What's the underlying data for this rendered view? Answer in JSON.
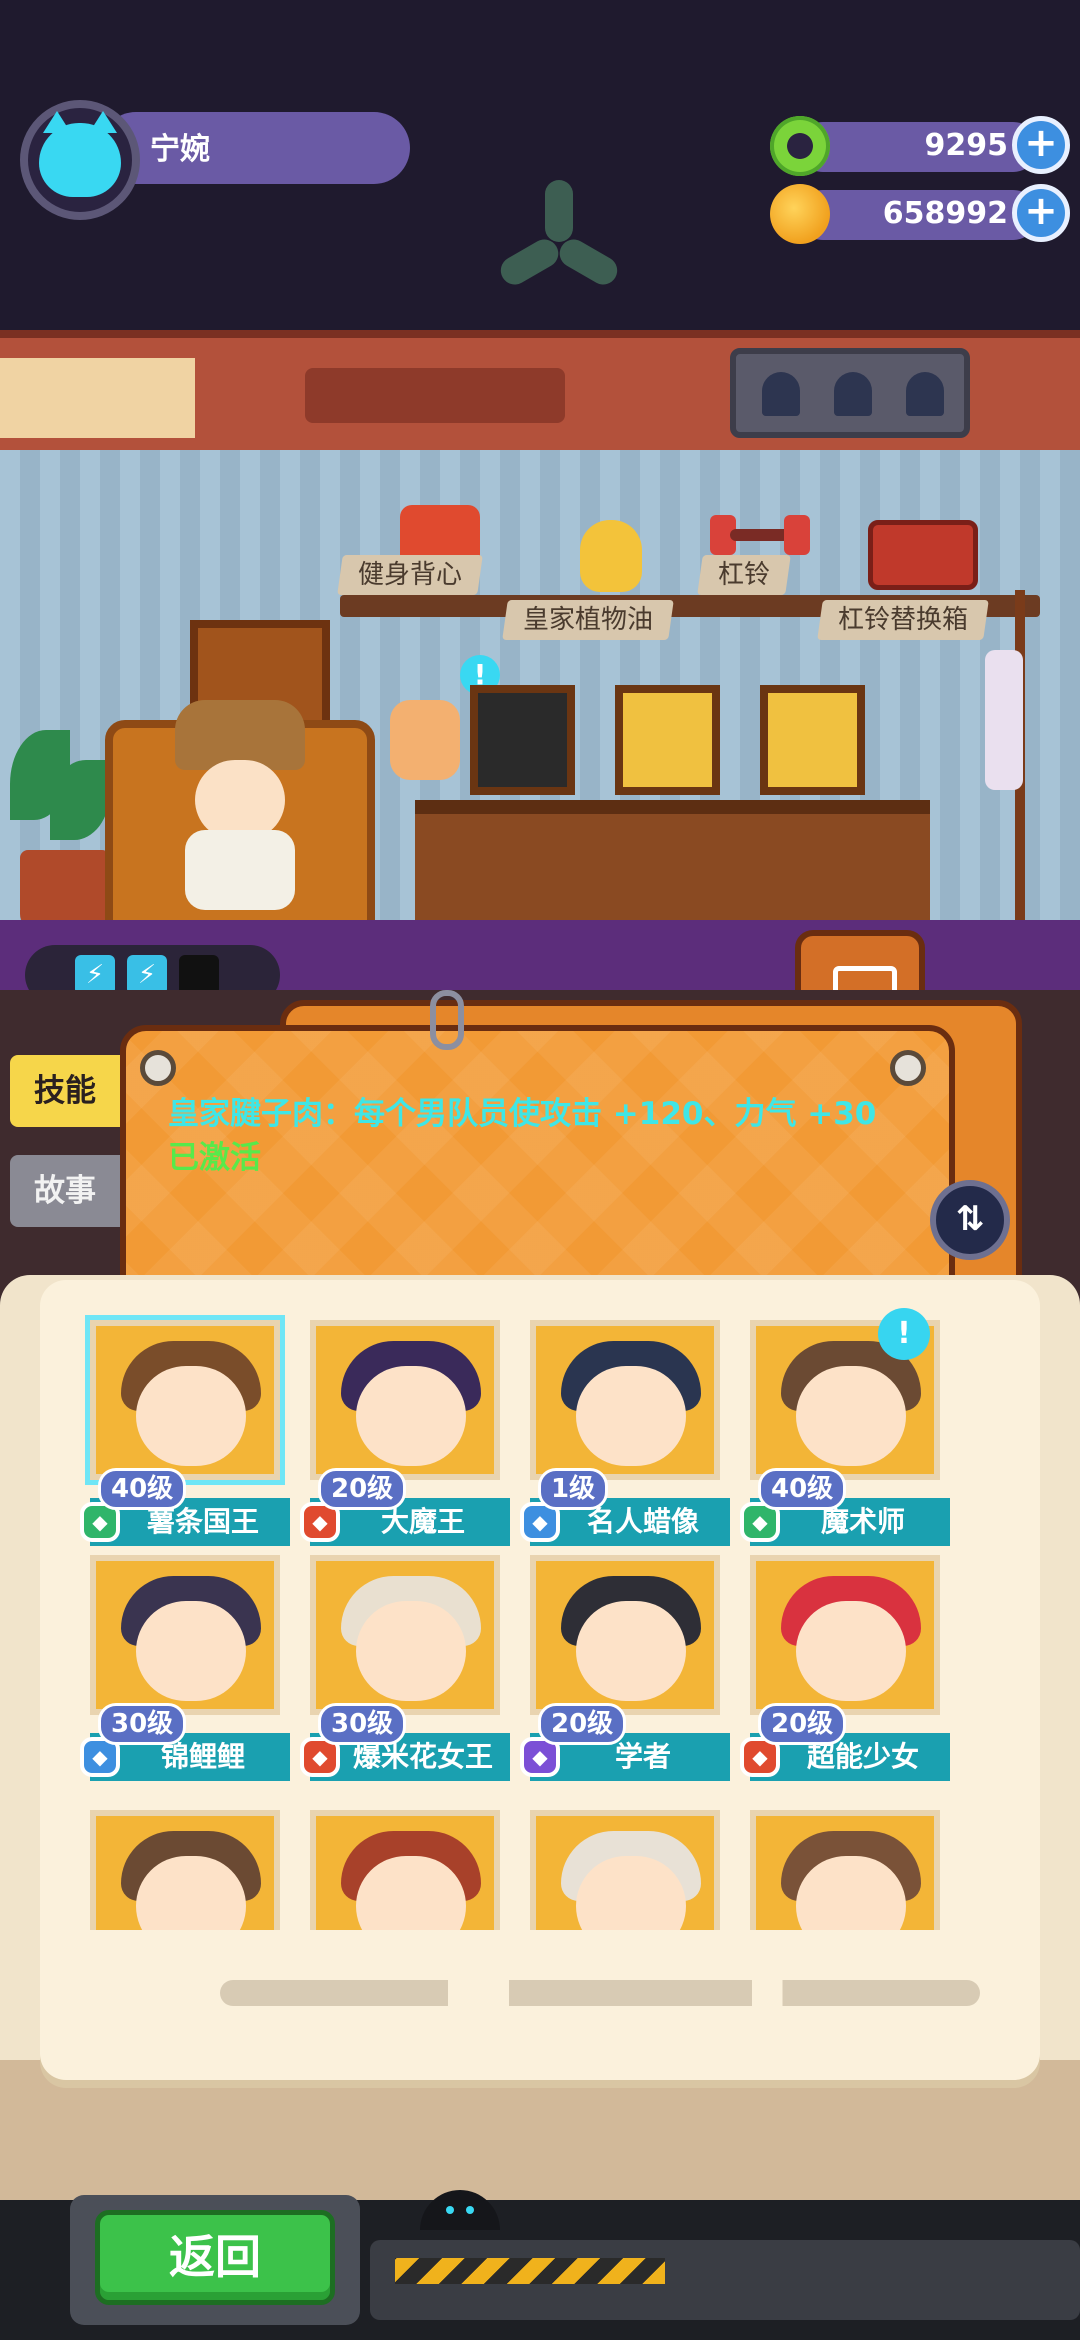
{
  "player": {
    "name": "宁婉",
    "avatar_icon": "cat-avatar-icon"
  },
  "resources": [
    {
      "name": "donut-currency",
      "value": "9295",
      "icon": "donut-icon",
      "plus": "+"
    },
    {
      "name": "coin-currency",
      "value": "658992",
      "icon": "planet-coin-icon",
      "plus": "+"
    }
  ],
  "shelf_items": [
    "健身背心",
    "皇家植物油",
    "杠铃",
    "杠铃替换箱"
  ],
  "notice_mark": "!",
  "side_tabs": {
    "skill": "技能",
    "story": "故事"
  },
  "skill": {
    "text": "皇家腱子肉：每个男队员使攻击 +120、力气 +30",
    "status": "已激活"
  },
  "swap_icon": "⇅",
  "heroes": [
    {
      "level": "40级",
      "name": "薯条国王",
      "badge_color": "#2fb56a",
      "hair": "#7a4d2a",
      "selected": true
    },
    {
      "level": "20级",
      "name": "大魔王",
      "badge_color": "#e04a2f",
      "hair": "#3a2a5a"
    },
    {
      "level": "1级",
      "name": "名人蜡像",
      "badge_color": "#3d8fe0",
      "hair": "#2a3550"
    },
    {
      "level": "40级",
      "name": "魔术师",
      "badge_color": "#2fb56a",
      "hair": "#6b4a33",
      "notice": true
    },
    {
      "level": "30级",
      "name": "锦鲤鲤",
      "badge_color": "#3d8fe0",
      "hair": "#3a3450"
    },
    {
      "level": "30级",
      "name": "爆米花女王",
      "badge_color": "#e04a2f",
      "hair": "#e9e0d0"
    },
    {
      "level": "20级",
      "name": "学者",
      "badge_color": "#7b4fd6",
      "hair": "#2e2e36"
    },
    {
      "level": "20级",
      "name": "超能少女",
      "badge_color": "#e04a2f",
      "hair": "#d9323f"
    }
  ],
  "partial_heroes": [
    {
      "hair": "#6b4a33"
    },
    {
      "hair": "#a8412a"
    },
    {
      "hair": "#e8e1d6"
    },
    {
      "hair": "#7a5238"
    }
  ],
  "back_button": "返回"
}
